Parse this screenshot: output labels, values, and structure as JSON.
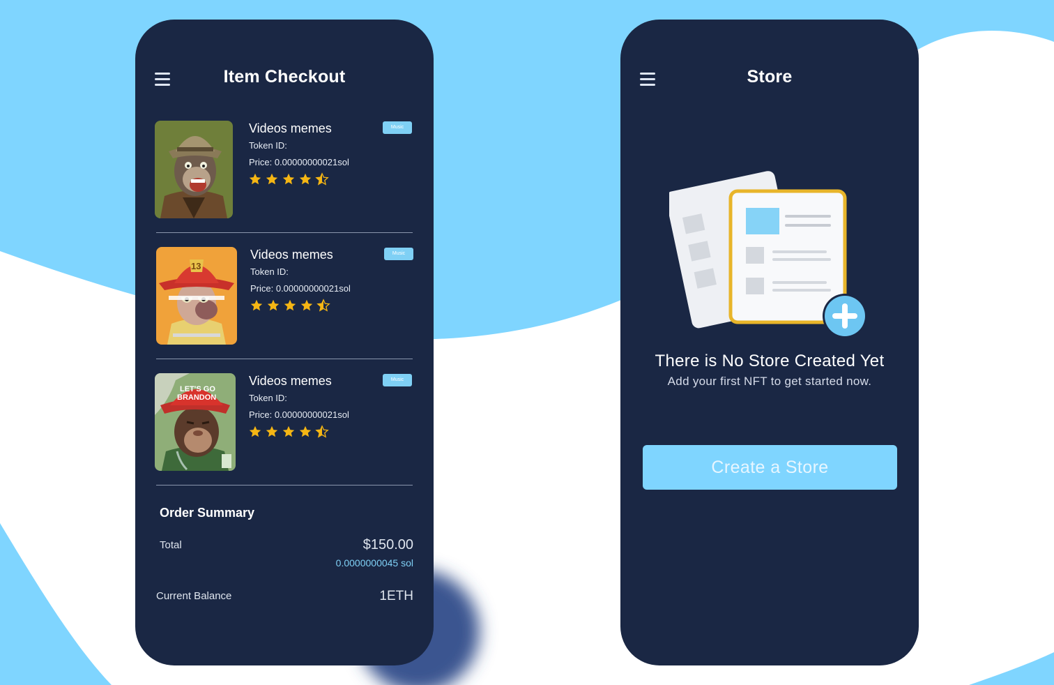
{
  "checkout": {
    "title": "Item Checkout",
    "items": [
      {
        "name": "Videos memes",
        "token_label": "Token ID:",
        "price_label": "Price: 0.00000000021sol",
        "tag": "Music",
        "rating": 4.5
      },
      {
        "name": "Videos memes",
        "token_label": "Token ID:",
        "price_label": "Price: 0.00000000021sol",
        "tag": "Music",
        "rating": 4.5
      },
      {
        "name": "Videos memes",
        "token_label": "Token ID:",
        "price_label": "Price: 0.00000000021sol",
        "tag": "Music",
        "rating": 4.5
      }
    ],
    "order_summary": {
      "title": "Order Summary",
      "total_label": "Total",
      "total_usd": "$150.00",
      "total_sol": "0.0000000045 sol",
      "balance_label": "Current Balance",
      "balance_value": "1ETH"
    }
  },
  "store": {
    "title": "Store",
    "empty_title": "There is No Store Created Yet",
    "empty_subtitle": "Add your first NFT to get  started now.",
    "create_button": "Create a Store"
  },
  "colors": {
    "background": "#7fd5ff",
    "phone": "#1a2744",
    "accent": "#7fd5ff",
    "star": "#f5b614"
  }
}
